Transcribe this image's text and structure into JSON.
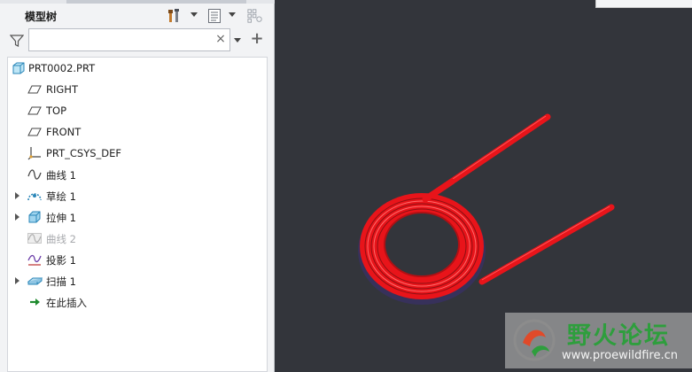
{
  "panel": {
    "title": "模型树",
    "search": {
      "value": "",
      "placeholder": ""
    },
    "clear_glyph": "×",
    "add_glyph": "+"
  },
  "tree": {
    "items": [
      {
        "label": "PRT0002.PRT",
        "icon": "part-icon",
        "expandable": false,
        "dimmed": false
      },
      {
        "label": "RIGHT",
        "icon": "datum-plane-icon",
        "expandable": false,
        "dimmed": false
      },
      {
        "label": "TOP",
        "icon": "datum-plane-icon",
        "expandable": false,
        "dimmed": false
      },
      {
        "label": "FRONT",
        "icon": "datum-plane-icon",
        "expandable": false,
        "dimmed": false
      },
      {
        "label": "PRT_CSYS_DEF",
        "icon": "csys-icon",
        "expandable": false,
        "dimmed": false
      },
      {
        "label": "曲线 1",
        "icon": "curve-icon",
        "expandable": false,
        "dimmed": false
      },
      {
        "label": "草绘 1",
        "icon": "sketch-icon",
        "expandable": true,
        "dimmed": false
      },
      {
        "label": "拉伸 1",
        "icon": "extrude-icon",
        "expandable": true,
        "dimmed": false
      },
      {
        "label": "曲线 2",
        "icon": "curve-icon",
        "expandable": false,
        "dimmed": true
      },
      {
        "label": "投影 1",
        "icon": "projection-icon",
        "expandable": false,
        "dimmed": false
      },
      {
        "label": "扫描 1",
        "icon": "sweep-icon",
        "expandable": true,
        "dimmed": false
      },
      {
        "label": "在此插入",
        "icon": "insert-here-icon",
        "expandable": false,
        "dimmed": false
      }
    ]
  },
  "watermark": {
    "title": "野火论坛",
    "url": "www.proewildfire.cn"
  },
  "colors": {
    "model": "#e8141a",
    "background": "#33353b",
    "watermark_green": "#2e9e3d"
  }
}
